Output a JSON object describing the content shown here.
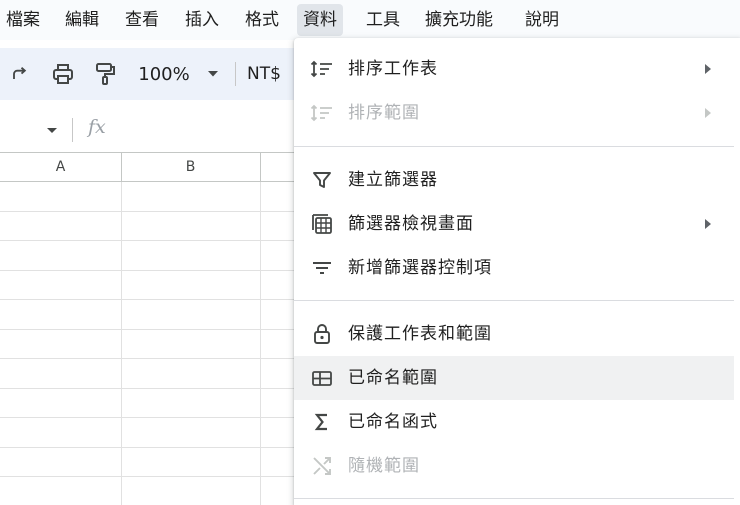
{
  "menubar": {
    "items": [
      {
        "label": "檔案"
      },
      {
        "label": "編輯"
      },
      {
        "label": "查看"
      },
      {
        "label": "插入"
      },
      {
        "label": "格式"
      },
      {
        "label": "資料",
        "active": true
      },
      {
        "label": "工具"
      },
      {
        "label": "擴充功能"
      },
      {
        "label": "說明"
      }
    ]
  },
  "toolbar": {
    "zoom": "100%",
    "currency": "NT$",
    "icons": [
      "redo-icon",
      "print-icon",
      "paint-format-icon",
      "zoom-dropdown-icon"
    ]
  },
  "formula_bar": {
    "fx": "fx"
  },
  "grid": {
    "columns": [
      "A",
      "B"
    ]
  },
  "data_menu": {
    "items": [
      {
        "label": "排序工作表",
        "icon": "sort-icon",
        "submenu": true,
        "disabled": false
      },
      {
        "label": "排序範圍",
        "icon": "sort-range-icon",
        "submenu": true,
        "disabled": true
      },
      {
        "label": "建立篩選器",
        "icon": "filter-icon",
        "submenu": false,
        "disabled": false
      },
      {
        "label": "篩選器檢視畫面",
        "icon": "filter-views-icon",
        "submenu": true,
        "disabled": false
      },
      {
        "label": "新增篩選器控制項",
        "icon": "filter-controls-icon",
        "submenu": false,
        "disabled": false
      },
      {
        "label": "保護工作表和範圍",
        "icon": "lock-icon",
        "submenu": false,
        "disabled": false
      },
      {
        "label": "已命名範圍",
        "icon": "named-range-icon",
        "submenu": false,
        "disabled": false,
        "hover": true
      },
      {
        "label": "已命名函式",
        "icon": "sigma-icon",
        "submenu": false,
        "disabled": false
      },
      {
        "label": "隨機範圍",
        "icon": "shuffle-icon",
        "submenu": false,
        "disabled": true
      }
    ]
  },
  "colors": {
    "menubar_bg": "#f9fbfd",
    "toolbar_bg": "#edf2fa",
    "active_menu_bg": "#e1e5ea",
    "hover_item_bg": "#f0f1f2",
    "disabled_text": "#b0b3b6"
  }
}
